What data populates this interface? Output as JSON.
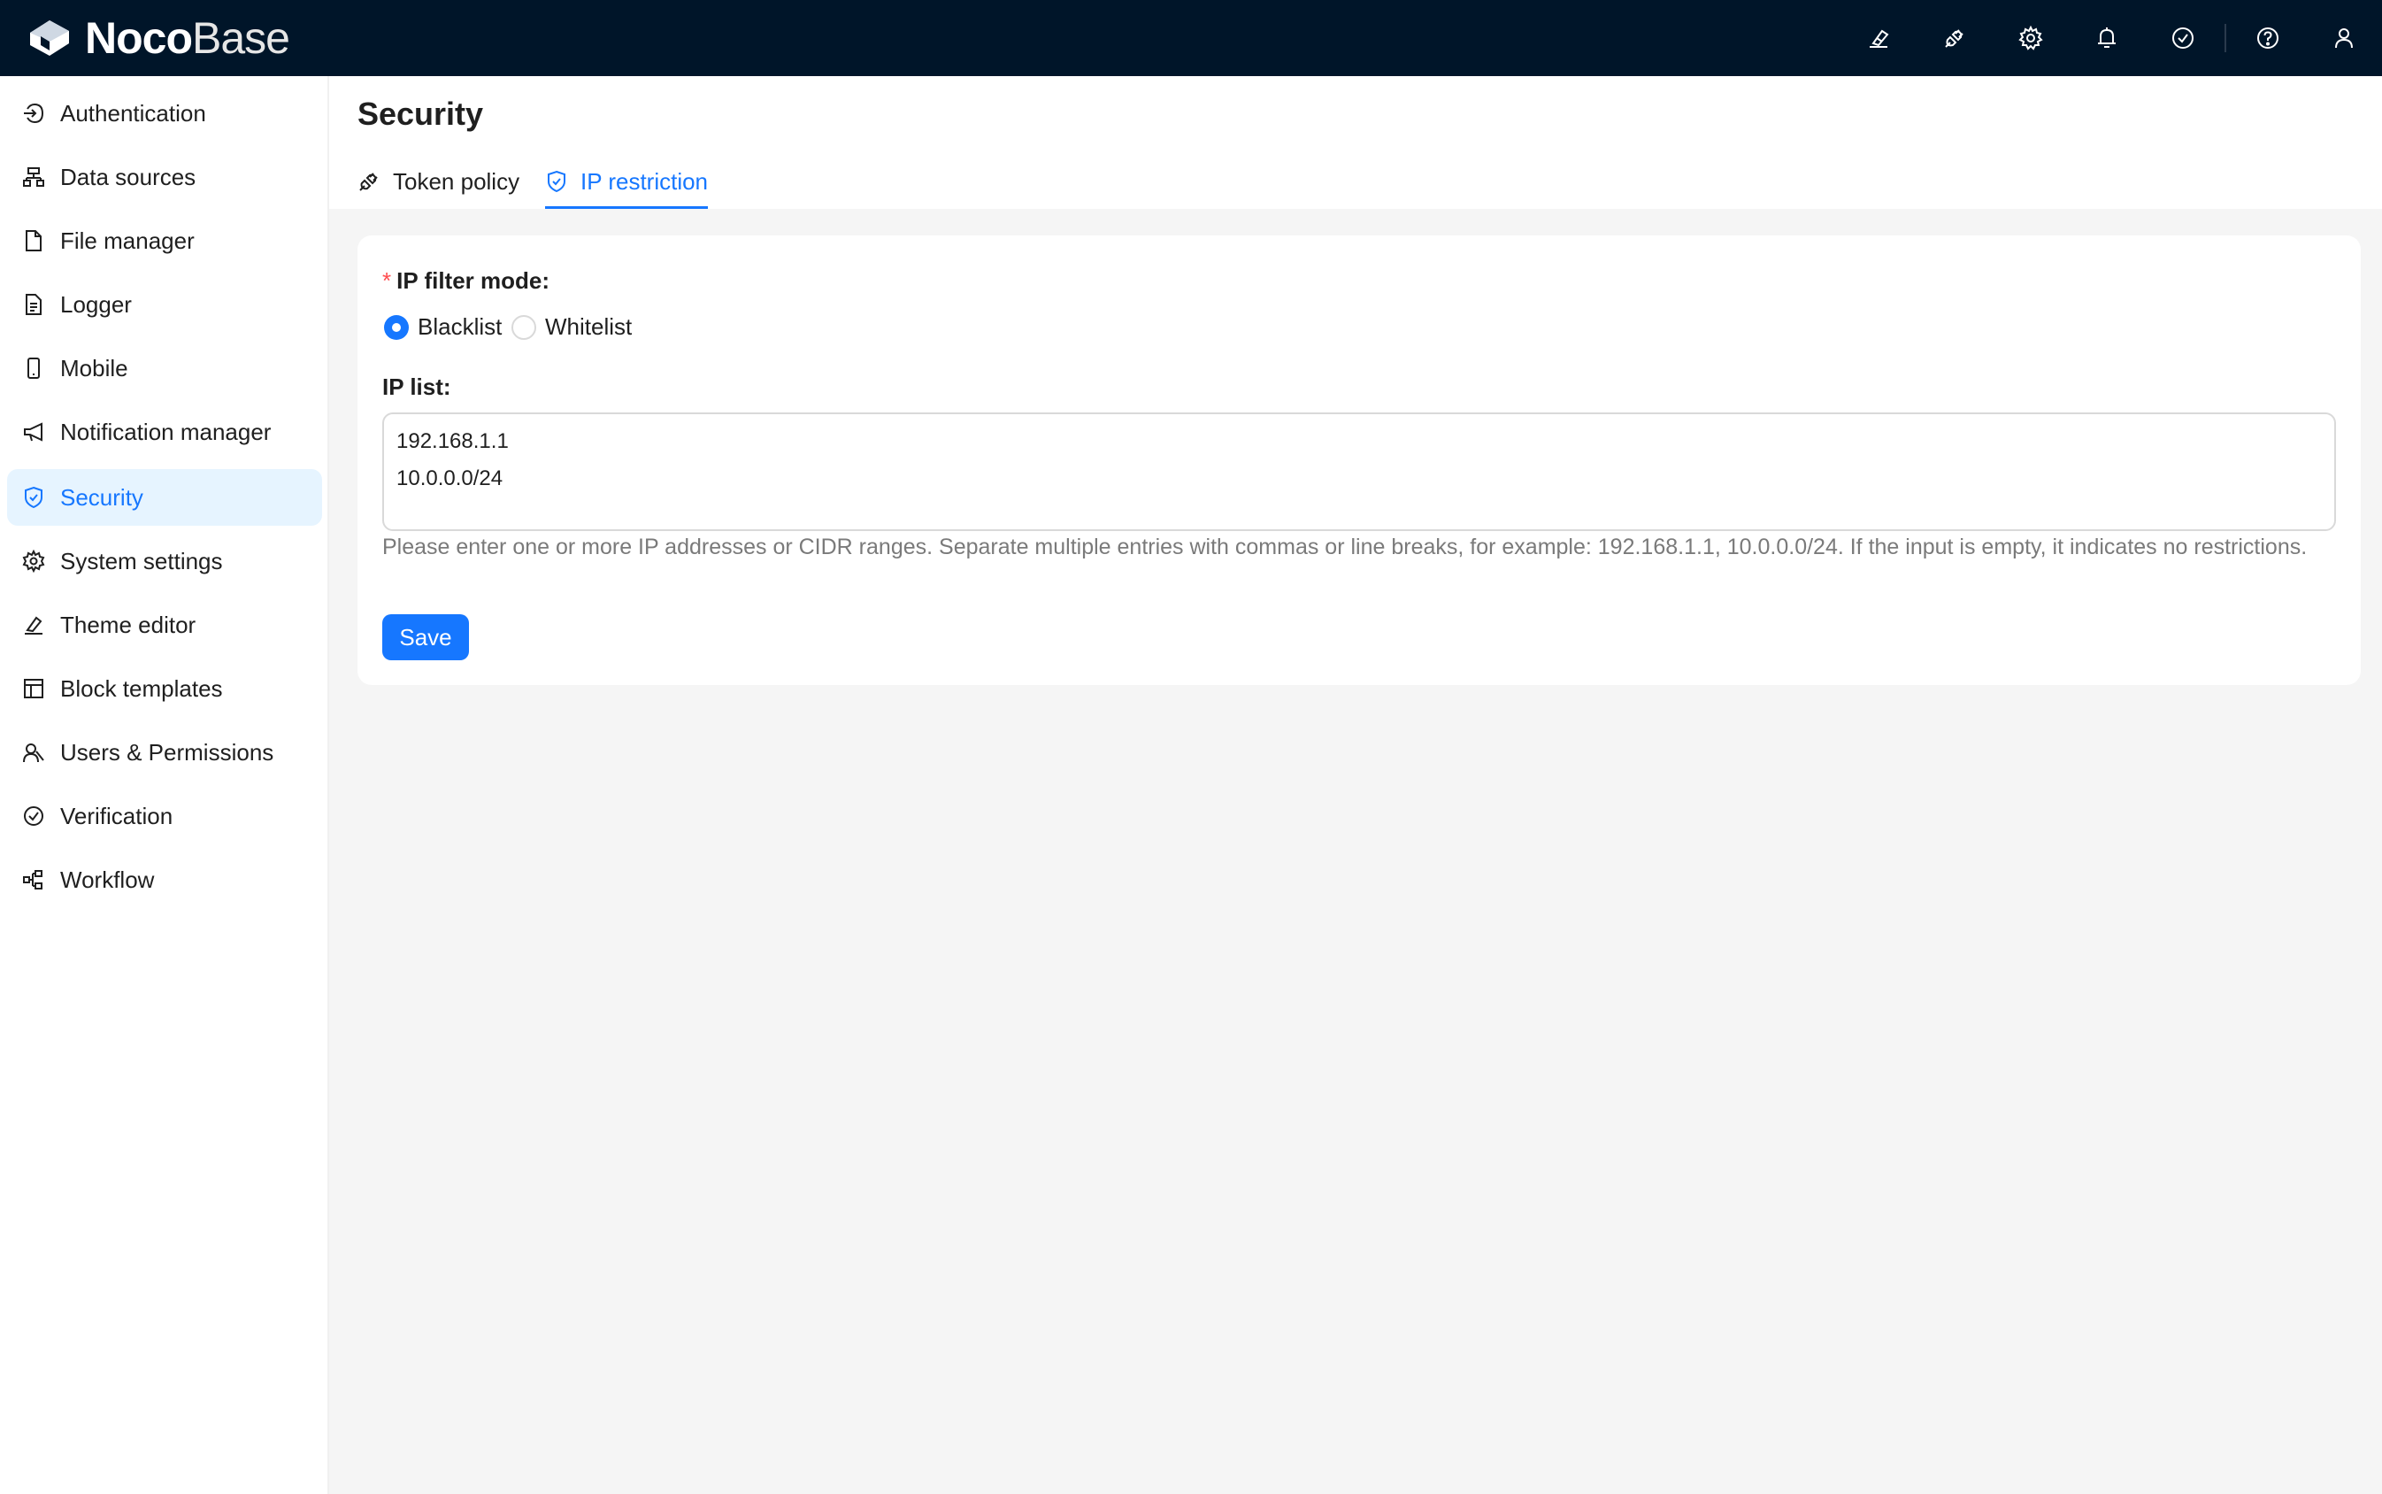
{
  "app": {
    "logo_text_bold": "Noco",
    "logo_text_light": "Base",
    "header_bg": "#001529",
    "accent": "#1677ff"
  },
  "topbar": {
    "icons": [
      "theme-brush-icon",
      "plugin-icon",
      "settings-gear-icon",
      "bell-icon",
      "check-circle-icon",
      "help-icon",
      "user-icon"
    ]
  },
  "sidebar": {
    "items": [
      {
        "label": "Authentication",
        "icon": "login-icon"
      },
      {
        "label": "Data sources",
        "icon": "database-icon"
      },
      {
        "label": "File manager",
        "icon": "file-icon"
      },
      {
        "label": "Logger",
        "icon": "file-text-icon"
      },
      {
        "label": "Mobile",
        "icon": "mobile-icon"
      },
      {
        "label": "Notification manager",
        "icon": "megaphone-icon"
      },
      {
        "label": "Security",
        "icon": "shield-icon",
        "active": true
      },
      {
        "label": "System settings",
        "icon": "gear-icon"
      },
      {
        "label": "Theme editor",
        "icon": "brush-icon"
      },
      {
        "label": "Block templates",
        "icon": "layout-icon"
      },
      {
        "label": "Users & Permissions",
        "icon": "users-icon"
      },
      {
        "label": "Verification",
        "icon": "check-circle-icon"
      },
      {
        "label": "Workflow",
        "icon": "workflow-icon"
      }
    ]
  },
  "page": {
    "title": "Security",
    "tabs": [
      {
        "label": "Token policy",
        "icon": "plug-icon"
      },
      {
        "label": "IP restriction",
        "icon": "shield-icon",
        "active": true
      }
    ]
  },
  "form": {
    "filter_mode_label": "IP filter mode",
    "required_mark": "*",
    "label_suffix": ":",
    "options": [
      {
        "label": "Blacklist",
        "checked": true
      },
      {
        "label": "Whitelist",
        "checked": false
      }
    ],
    "ip_list_label": "IP list",
    "ip_list_lines": [
      "192.168.1.1",
      "10.0.0.0/24"
    ],
    "help_text": "Please enter one or more IP addresses or CIDR ranges. Separate multiple entries with commas or line breaks, for example: 192.168.1.1, 10.0.0.0/24. If the input is empty, it indicates no restrictions.",
    "save_label": "Save"
  }
}
